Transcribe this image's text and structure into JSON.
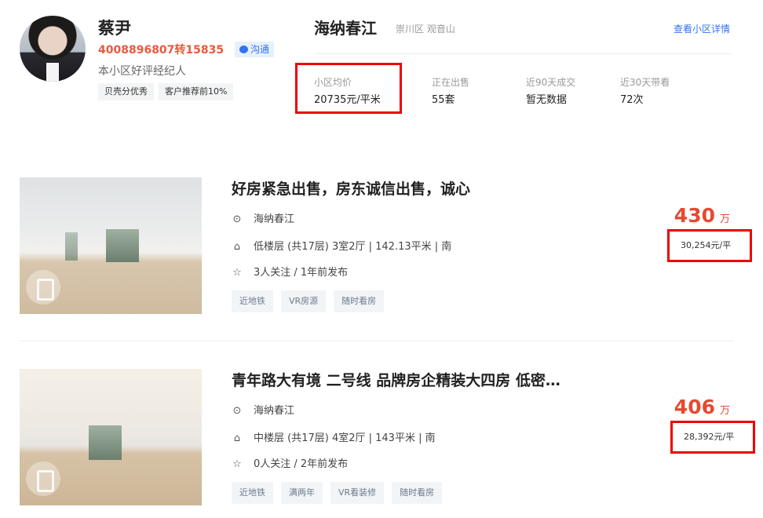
{
  "agent": {
    "name": "蔡尹",
    "phone": "4008896807转15835",
    "chat_label": "沟通",
    "desc": "本小区好评经纪人",
    "tags": [
      "贝壳分优秀",
      "客户推荐前10%"
    ]
  },
  "community": {
    "name": "海纳春江",
    "location": "崇川区 观音山",
    "detail_link": "查看小区详情",
    "stats": [
      {
        "label": "小区均价",
        "value": "20735元/平米"
      },
      {
        "label": "正在出售",
        "value": "55套"
      },
      {
        "label": "近90天成交",
        "value": "暂无数据"
      },
      {
        "label": "近30天带看",
        "value": "72次"
      }
    ]
  },
  "listings": [
    {
      "title": "好房紧急出售，房东诚信出售，诚心",
      "community": "海纳春江",
      "info": "低楼层 (共17层) 3室2厅 | 142.13平米 | 南",
      "follow": "3人关注 / 1年前发布",
      "tags": [
        "近地铁",
        "VR房源",
        "随时看房"
      ],
      "price": "430",
      "price_unit": "万",
      "unit_price": "30,254元/平"
    },
    {
      "title": "青年路大有境 二号线 品牌房企精装大四房 低密…",
      "community": "海纳春江",
      "info": "中楼层 (共17层) 4室2厅 | 143平米 | 南",
      "follow": "0人关注 / 2年前发布",
      "tags": [
        "近地铁",
        "满两年",
        "VR看装修",
        "随时看房"
      ],
      "price": "406",
      "price_unit": "万",
      "unit_price": "28,392元/平"
    }
  ],
  "icons": {
    "location": "location-pin-icon",
    "house": "house-icon",
    "star": "star-icon",
    "chat": "chat-bubble-icon",
    "vr": "vr-icon"
  },
  "colors": {
    "price": "#e44a30",
    "phone": "#e65a3e",
    "link": "#3072f6",
    "highlight_box": "#ee0000"
  }
}
